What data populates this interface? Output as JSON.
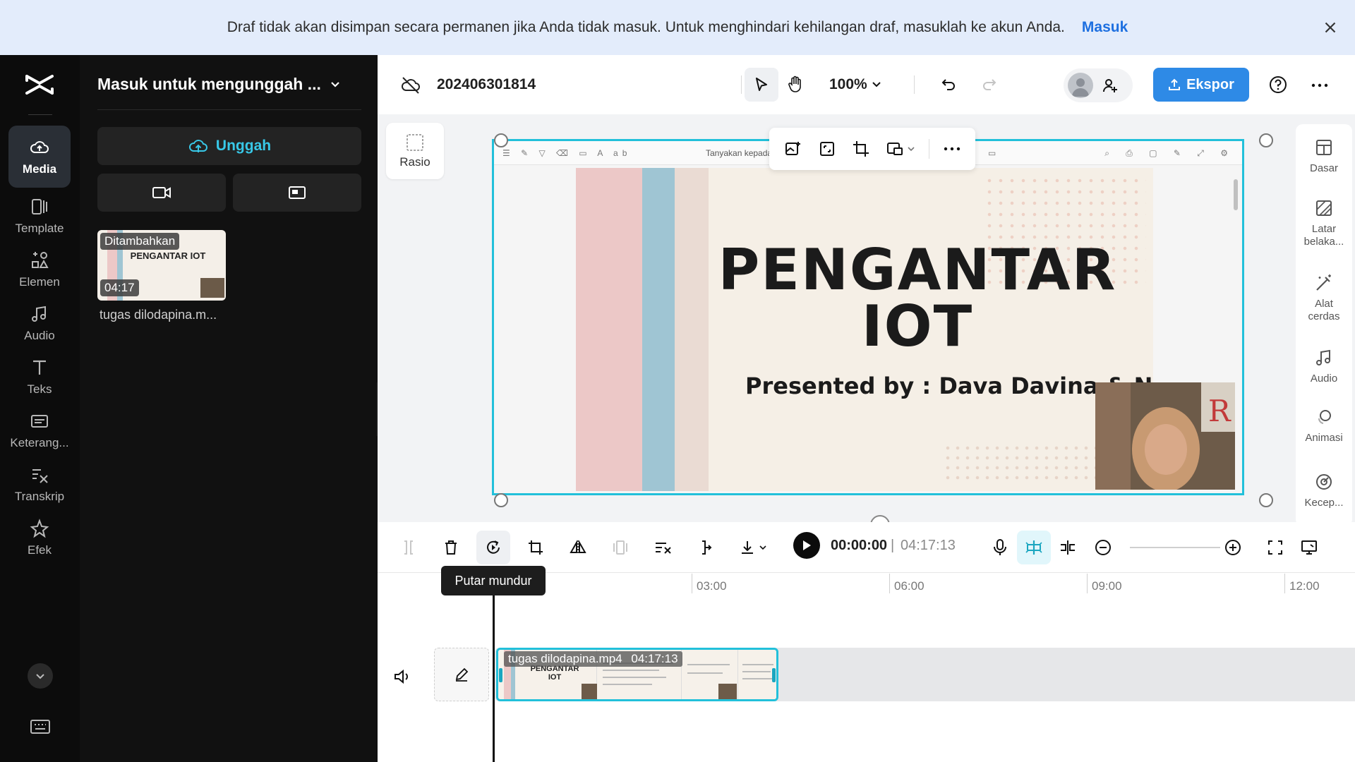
{
  "banner": {
    "message": "Draf tidak akan disimpan secara permanen jika Anda tidak masuk. Untuk menghindari kehilangan draf, masuklah ke akun Anda.",
    "link": "Masuk"
  },
  "rail": {
    "items": [
      {
        "label": "Media",
        "icon": "cloud-icon"
      },
      {
        "label": "Template",
        "icon": "template-icon"
      },
      {
        "label": "Elemen",
        "icon": "elements-icon"
      },
      {
        "label": "Audio",
        "icon": "music-note-icon"
      },
      {
        "label": "Teks",
        "icon": "text-icon"
      },
      {
        "label": "Keterang...",
        "icon": "captions-icon"
      },
      {
        "label": "Transkrip",
        "icon": "transcript-icon"
      },
      {
        "label": "Efek",
        "icon": "effects-star-icon"
      }
    ]
  },
  "panel": {
    "header": "Masuk untuk mengunggah ...",
    "upload_label": "Unggah",
    "media": {
      "added_badge": "Ditambahkan",
      "duration": "04:17",
      "thumb_title": "PENGANTAR IOT",
      "filename": "tugas dilodapina.m..."
    }
  },
  "topbar": {
    "project_name": "202406301814",
    "zoom": "100%",
    "export_label": "Ekspor"
  },
  "canvas": {
    "ratio_label": "Rasio",
    "slide_toolbar_text": "Tanyakan kepada",
    "slide_title_line1": "PENGANTAR",
    "slide_title_line2": "IOT",
    "presenter": "Presented by : Dava Davina & Nadila"
  },
  "right_panel": {
    "items": [
      {
        "label": "Dasar"
      },
      {
        "label": "Latar belaka..."
      },
      {
        "label": "Alat cerdas"
      },
      {
        "label": "Audio"
      },
      {
        "label": "Animasi"
      },
      {
        "label": "Kecep..."
      }
    ]
  },
  "timeline_toolbar": {
    "current_time": "00:00:00",
    "total_time": "04:17:13",
    "tooltip": "Putar mundur"
  },
  "timeline": {
    "ruler": [
      "03:00",
      "06:00",
      "09:00",
      "12:00"
    ],
    "clip_label": "tugas dilodapina.mp4",
    "clip_duration": "04:17:13"
  },
  "colors": {
    "accent": "#22c0da",
    "export_button": "#2e8ae6",
    "banner_bg": "#e3ecfb",
    "link": "#1d6fe0"
  }
}
